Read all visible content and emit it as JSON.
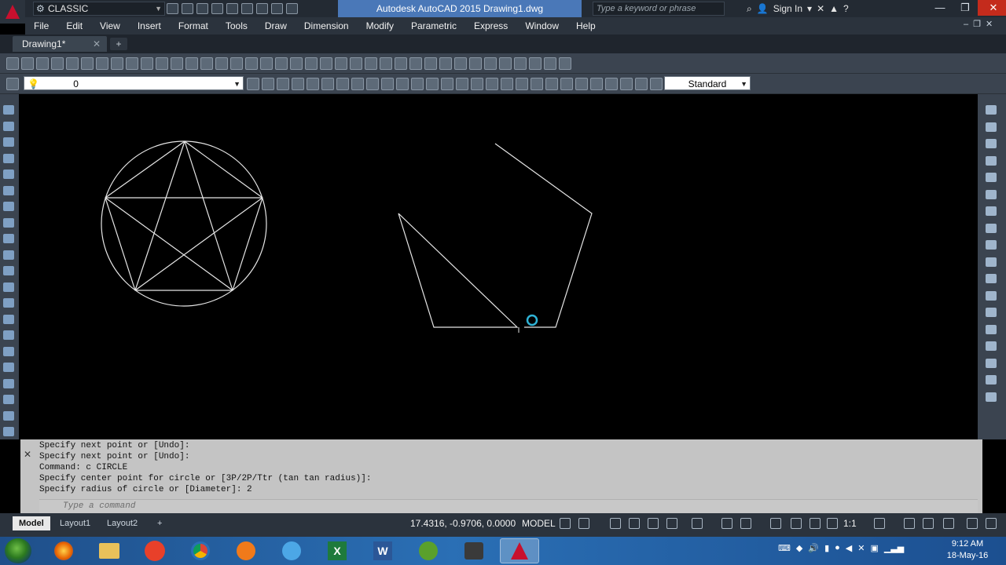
{
  "titlebar": {
    "workspace": "CLASSIC",
    "app_title": "Autodesk AutoCAD 2015    Drawing1.dwg",
    "search_placeholder": "Type a keyword or phrase",
    "signin": "Sign In"
  },
  "menu": [
    "File",
    "Edit",
    "View",
    "Insert",
    "Format",
    "Tools",
    "Draw",
    "Dimension",
    "Modify",
    "Parametric",
    "Express",
    "Window",
    "Help"
  ],
  "doc_tab": {
    "label": "Drawing1*",
    "close": "✕",
    "new": "+"
  },
  "layer_select": {
    "value": "0"
  },
  "style_select": {
    "value": "Standard"
  },
  "command": {
    "history": [
      "Specify next point or [Undo]:",
      "Specify next point or [Undo]:",
      "Command: c CIRCLE",
      "Specify center point for circle or [3P/2P/Ttr (tan tan radius)]:",
      "Specify radius of circle or [Diameter]: 2"
    ],
    "input_placeholder": "Type a command"
  },
  "layout_tabs": [
    "Model",
    "Layout1",
    "Layout2"
  ],
  "status": {
    "coords": "17.4316, -0.9706, 0.0000",
    "model": "MODEL",
    "scale": "1:1"
  },
  "clock": {
    "time": "9:12 AM",
    "date": "18-May-16"
  },
  "taskbar_apps": [
    "start",
    "firefox",
    "explorer",
    "notepad",
    "chrome",
    "media-player",
    "ie",
    "excel",
    "word",
    "utorrent",
    "camtasia",
    "autocad"
  ]
}
